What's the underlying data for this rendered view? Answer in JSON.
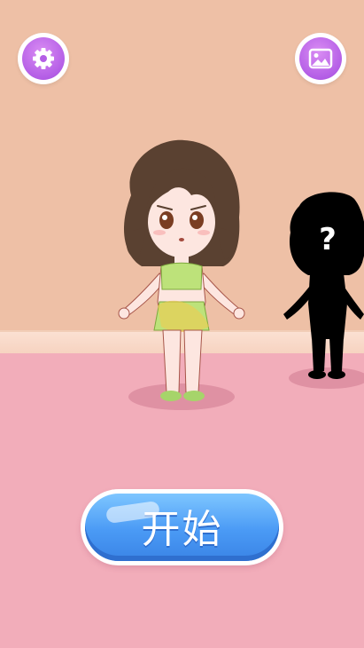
{
  "top_bar": {
    "settings_icon": "gear-icon",
    "gallery_icon": "image-icon"
  },
  "stage": {
    "player_character": "girl-character",
    "mystery_character": "silhouette-character",
    "mystery_symbol": "?"
  },
  "start_button": {
    "label": "开始"
  },
  "colors": {
    "wall": "#eec0a6",
    "floor": "#f2adba",
    "button_purple": "#b45ee6",
    "button_blue": "#4a9af5",
    "outfit_green": "#bde27a"
  }
}
